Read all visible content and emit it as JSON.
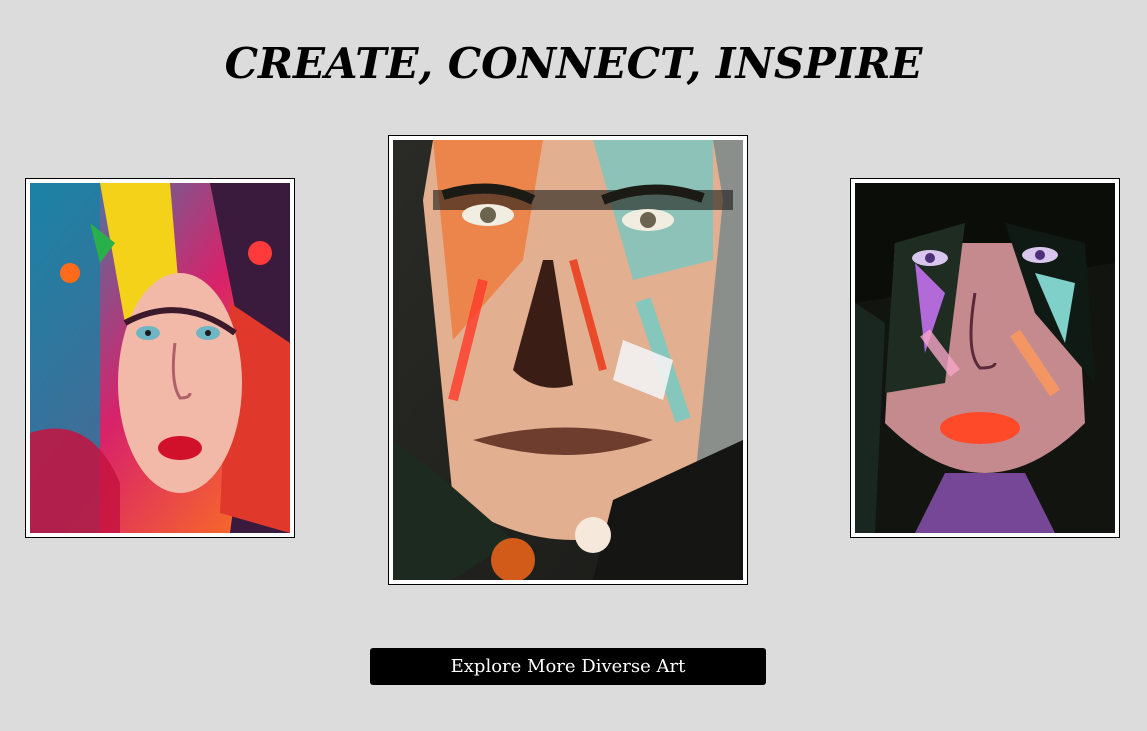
{
  "header": {
    "title": "CREATE, CONNECT, INSPIRE"
  },
  "gallery": {
    "paintings": [
      {
        "subject": "woman-portrait",
        "style": "colorful palette-knife portrait"
      },
      {
        "subject": "man-portrait",
        "style": "colorful palette-knife portrait"
      },
      {
        "subject": "woman-portrait-dark",
        "style": "colorful palette-knife portrait"
      }
    ]
  },
  "actions": {
    "explore_label": "Explore More Diverse Art"
  },
  "colors": {
    "background": "#dcdcdc",
    "button_bg": "#000000",
    "button_text": "#ffffff",
    "frame": "#ffffff"
  }
}
